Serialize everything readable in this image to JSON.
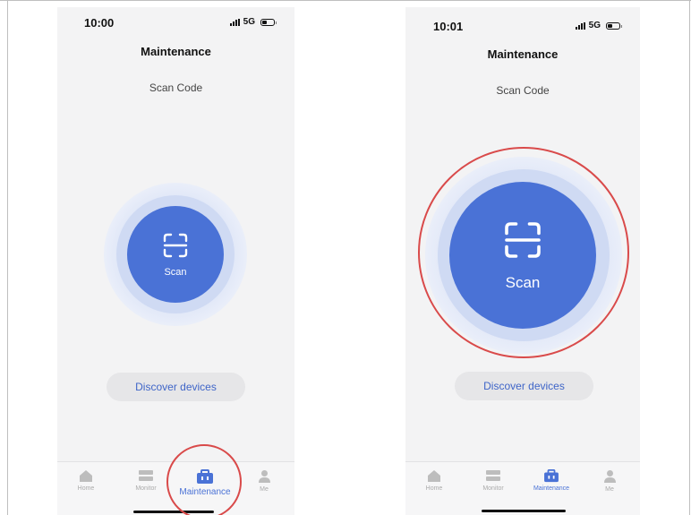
{
  "screens": [
    {
      "status_time": "10:00",
      "network": "5G",
      "title": "Maintenance",
      "subtitle": "Scan Code",
      "scan_label": "Scan",
      "discover_label": "Discover devices",
      "tabs": [
        "Home",
        "Monitor",
        "Maintenance",
        "Me"
      ],
      "active_tab": "Maintenance",
      "highlight": "maintenance-tab"
    },
    {
      "status_time": "10:01",
      "network": "5G",
      "title": "Maintenance",
      "subtitle": "Scan Code",
      "scan_label": "Scan",
      "discover_label": "Discover devices",
      "tabs": [
        "Home",
        "Monitor",
        "Maintenance",
        "Me"
      ],
      "active_tab": "Maintenance",
      "highlight": "scan-button"
    }
  ],
  "colors": {
    "accent": "#4a72d6",
    "annotation": "#d94a4a",
    "background": "#f3f3f4"
  }
}
